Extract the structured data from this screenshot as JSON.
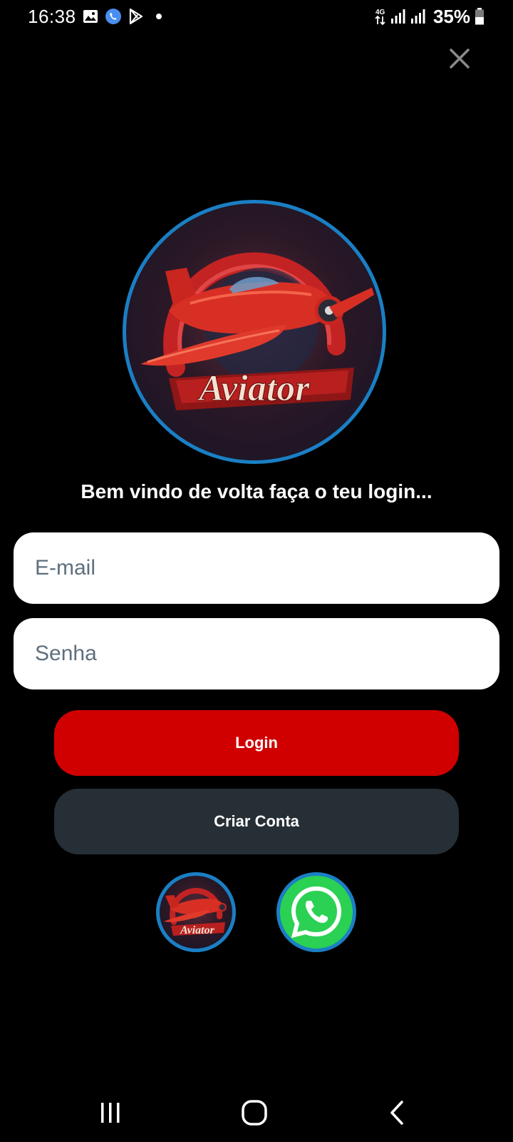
{
  "status_bar": {
    "time": "16:38",
    "network": "4G",
    "battery": "35%",
    "left_icons": [
      "gallery-icon",
      "whatsapp-icon",
      "play-store-icon",
      "notification-dot-icon"
    ],
    "right_icons": [
      "data-arrows-icon",
      "signal-icon",
      "signal-icon",
      "battery-icon"
    ]
  },
  "header": {
    "close_icon": "close-icon"
  },
  "logo": {
    "text": "Aviator"
  },
  "welcome": {
    "text": "Bem vindo de volta faça o teu login..."
  },
  "form": {
    "email_placeholder": "E-mail",
    "email_value": "",
    "password_placeholder": "Senha",
    "password_value": "",
    "login_label": "Login",
    "create_account_label": "Criar Conta"
  },
  "social": {
    "aviator_text": "Aviator",
    "whatsapp_icon": "whatsapp-icon"
  },
  "nav_bar": {
    "items": [
      "recents-icon",
      "home-icon",
      "back-icon"
    ]
  },
  "colors": {
    "background": "#000000",
    "login_button": "#d10000",
    "create_button": "#262f36",
    "ring": "#1a7fc4",
    "whatsapp": "#2bd153",
    "placeholder": "#5e6f7e"
  }
}
